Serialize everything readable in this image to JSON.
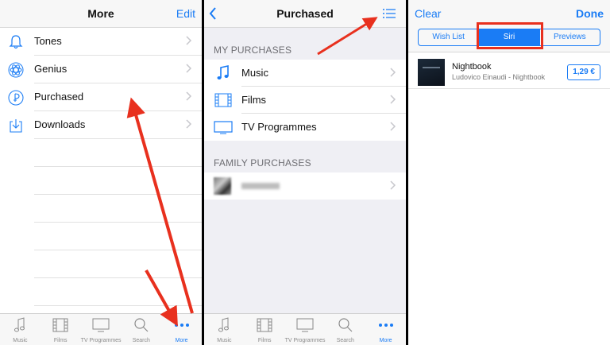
{
  "colors": {
    "accent": "#1a7cf5",
    "annotation": "#e8301e"
  },
  "left_panel": {
    "title": "More",
    "edit_label": "Edit",
    "items": [
      {
        "label": "Tones",
        "icon": "bell-icon"
      },
      {
        "label": "Genius",
        "icon": "atom-icon"
      },
      {
        "label": "Purchased",
        "icon": "purchased-icon"
      },
      {
        "label": "Downloads",
        "icon": "download-icon"
      }
    ]
  },
  "tabs": [
    {
      "label": "Music",
      "icon": "music-note-icon"
    },
    {
      "label": "Films",
      "icon": "film-icon"
    },
    {
      "label": "TV Programmes",
      "icon": "tv-icon"
    },
    {
      "label": "Search",
      "icon": "search-icon"
    },
    {
      "label": "More",
      "icon": "more-dots-icon",
      "active": true
    }
  ],
  "middle_panel": {
    "title": "Purchased",
    "my_purchases_header": "MY PURCHASES",
    "items": [
      {
        "label": "Music",
        "icon": "music-note-icon"
      },
      {
        "label": "Films",
        "icon": "film-icon"
      },
      {
        "label": "TV Programmes",
        "icon": "tv-icon"
      }
    ],
    "family_purchases_header": "FAMILY PURCHASES"
  },
  "right_panel": {
    "clear_label": "Clear",
    "done_label": "Done",
    "segments": [
      "Wish List",
      "Siri",
      "Previews"
    ],
    "selected_segment": "Siri",
    "song": {
      "title": "Nightbook",
      "artist": "Ludovico Einaudi - Nightbook",
      "price": "1,29 €"
    }
  }
}
